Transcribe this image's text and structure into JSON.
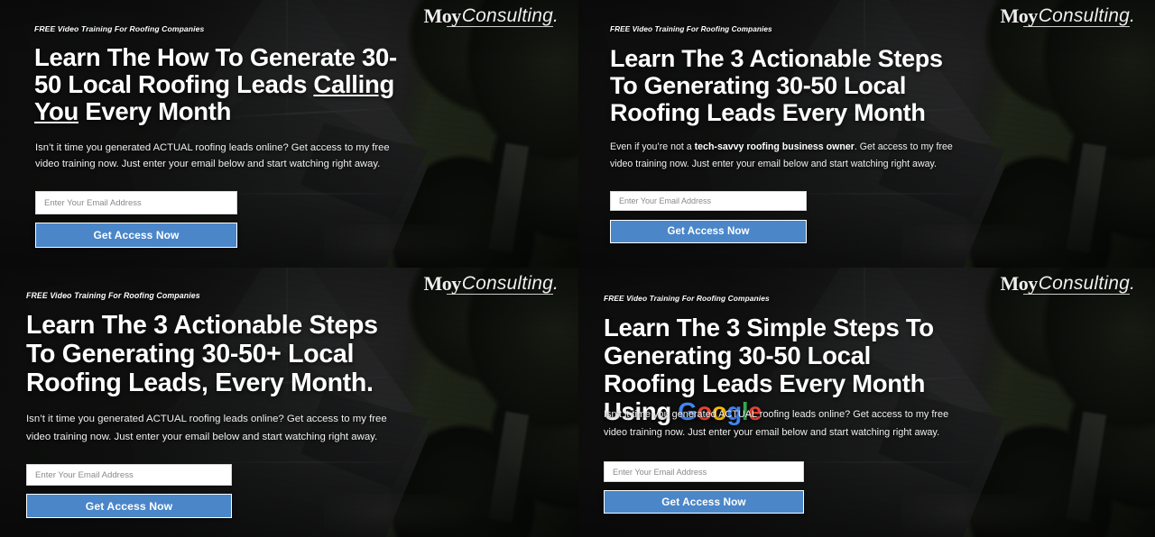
{
  "brand": {
    "logo_mark": "Moy",
    "logo_word": "Consulting.",
    "accent_blue": "#4a86c8",
    "google_colors": {
      "blue": "#4285F4",
      "red": "#EA4335",
      "yellow": "#FBBC05",
      "green": "#34A853"
    }
  },
  "panels": [
    {
      "id": "p1",
      "eyebrow": "FREE Video Training For Roofing Companies",
      "headline_plain": "Learn The How To Generate 30-50 Local Roofing Leads Calling You Every Month",
      "headline_parts": [
        {
          "text": "Learn The How To Generate 30-50 Local Roofing Leads ",
          "style": "normal"
        },
        {
          "text": "Calling You",
          "style": "underline"
        },
        {
          "text": " Every Month",
          "style": "normal"
        }
      ],
      "subtext_plain": "Isn’t it time you generated ACTUAL roofing leads online? Get access to my free video training now. Just enter your email below and start watching right away.",
      "subtext_parts": [
        {
          "text": "Isn’t it time you generated ACTUAL roofing leads online? Get access to my free video training now. Just enter your email below and start watching right away.",
          "style": "normal"
        }
      ],
      "email_placeholder": "Enter Your Email Address",
      "email_value": "",
      "cta_label": "Get Access Now"
    },
    {
      "id": "p2",
      "eyebrow": "FREE Video Training For Roofing Companies",
      "headline_plain": "Learn The 3 Actionable Steps To Generating 30-50 Local Roofing Leads Every Month",
      "headline_parts": [
        {
          "text": "Learn The 3 Actionable Steps To Generating 30-50 Local Roofing Leads Every Month",
          "style": "normal"
        }
      ],
      "subtext_plain": "Even if you’re not a tech-savvy roofing business owner. Get access to my free video training now. Just enter your email below and start watching right away.",
      "subtext_parts": [
        {
          "text": "Even if you’re not a ",
          "style": "normal"
        },
        {
          "text": "tech-savvy roofing business owner",
          "style": "bold"
        },
        {
          "text": ". Get access to my free video training now. Just enter your email below and start watching right away.",
          "style": "normal"
        }
      ],
      "email_placeholder": "Enter Your Email Address",
      "email_value": "",
      "cta_label": "Get Access Now"
    },
    {
      "id": "p3",
      "eyebrow": "FREE Video Training For Roofing Companies",
      "headline_plain": "Learn The 3 Actionable Steps To Generating 30-50+ Local Roofing Leads, Every Month.",
      "headline_parts": [
        {
          "text": "Learn The 3 Actionable Steps To Generating 30-50+ Local Roofing Leads, Every Month.",
          "style": "normal"
        }
      ],
      "subtext_plain": "Isn’t it time you generated ACTUAL roofing leads online? Get access to my free video training now. Just enter your email below and start watching right away.",
      "subtext_parts": [
        {
          "text": "Isn’t it time you generated ACTUAL roofing leads online? Get access to my free video training now. Just enter your email below and start watching right away.",
          "style": "normal"
        }
      ],
      "email_placeholder": "Enter Your Email Address",
      "email_value": "",
      "cta_label": "Get Access Now"
    },
    {
      "id": "p4",
      "eyebrow": "FREE Video Training For Roofing Companies",
      "headline_plain": "Learn The 3 Simple Steps To Generating 30-50 Local Roofing Leads Every Month Using Google",
      "headline_parts": [
        {
          "text": "Learn The 3 Simple Steps To Generating 30-50 Local Roofing Leads Every Month Using ",
          "style": "normal"
        },
        {
          "text": "G",
          "style": "google-blue"
        },
        {
          "text": "o",
          "style": "google-red"
        },
        {
          "text": "o",
          "style": "google-yellow"
        },
        {
          "text": "g",
          "style": "google-blue"
        },
        {
          "text": "l",
          "style": "google-green"
        },
        {
          "text": "e",
          "style": "google-red"
        }
      ],
      "subtext_plain": "Isn’t it time you generated ACTUAL roofing leads online? Get access to my free video training now. Just enter your email below and start watching right away.",
      "subtext_parts": [
        {
          "text": "Isn’t it time you generated ACTUAL roofing leads online? Get access to my free video training now. Just enter your email below and start watching right away.",
          "style": "normal"
        }
      ],
      "email_placeholder": "Enter Your Email Address",
      "email_value": "",
      "cta_label": "Get Access Now"
    }
  ]
}
